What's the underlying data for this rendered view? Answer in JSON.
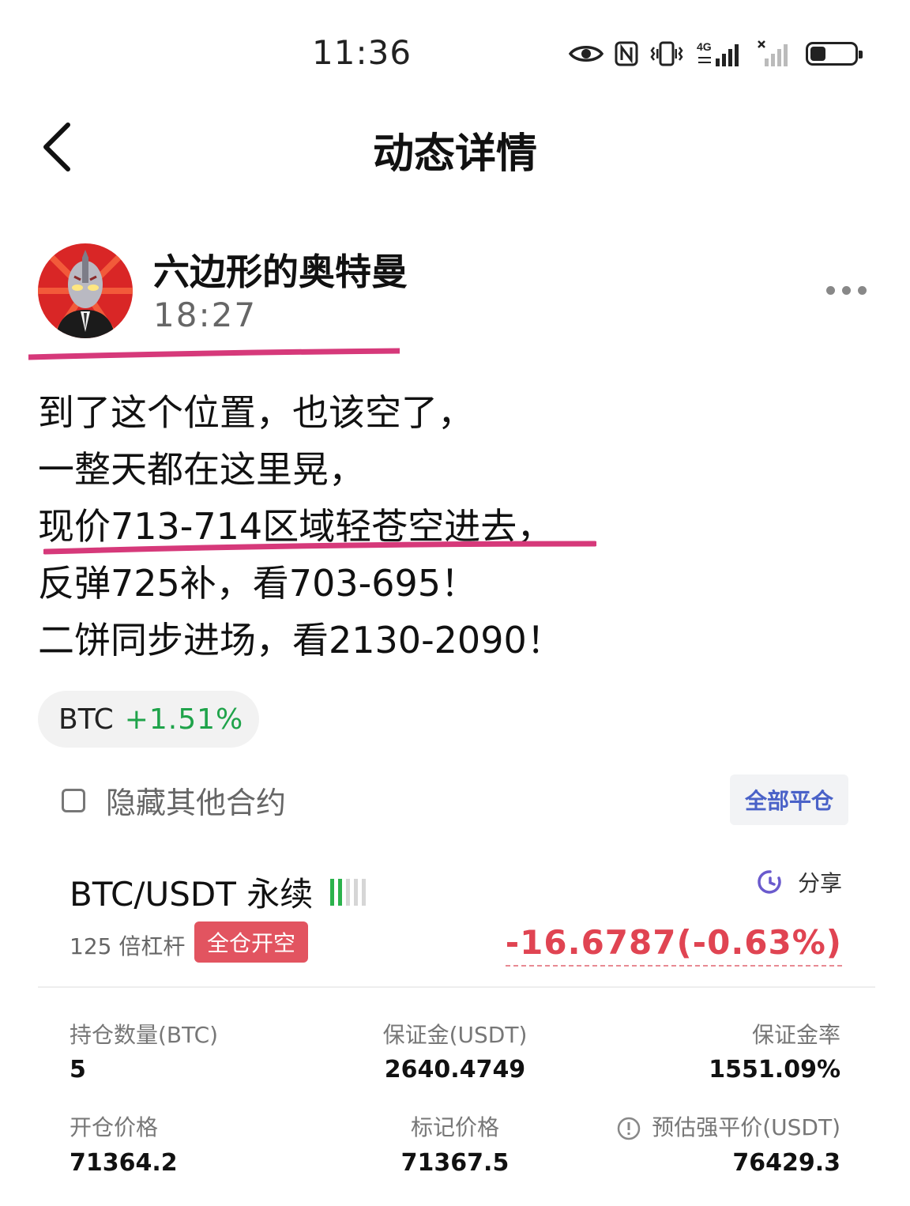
{
  "status_bar": {
    "time": "11:36",
    "network_label": "4G"
  },
  "nav": {
    "title": "动态详情"
  },
  "author": {
    "name": "六边形的奥特曼",
    "time": "18:27"
  },
  "post": {
    "lines": [
      "到了这个位置，也该空了，",
      "一整天都在这里晃，",
      "现价713-714区域轻苍空进去，",
      "反弹725补，看703-695！",
      "二饼同步进场，看2130-2090！"
    ]
  },
  "ticker": {
    "symbol": "BTC",
    "change": "+1.51%"
  },
  "filter": {
    "hide_label": "隐藏其他合约",
    "checked": false,
    "close_all_label": "全部平仓"
  },
  "position": {
    "pair": "BTC/USDT 永续",
    "leverage": "125 倍杠杆",
    "direction_tag": "全仓开空",
    "share_label": "分享",
    "pnl": "-16.6787(-0.63%)",
    "fields": [
      {
        "label": "持仓数量(BTC)",
        "value": "5"
      },
      {
        "label": "保证金(USDT)",
        "value": "2640.4749"
      },
      {
        "label": "保证金率",
        "value": "1551.09%"
      },
      {
        "label": "开仓价格",
        "value": "71364.2"
      },
      {
        "label": "标记价格",
        "value": "71367.5"
      },
      {
        "label": "预估强平价(USDT)",
        "value": "76429.3"
      }
    ]
  },
  "colors": {
    "positive": "#1fa34a",
    "negative": "#e04452",
    "accent": "#4a62c8",
    "highlight": "#d6397a"
  },
  "battery_level": 0.35
}
